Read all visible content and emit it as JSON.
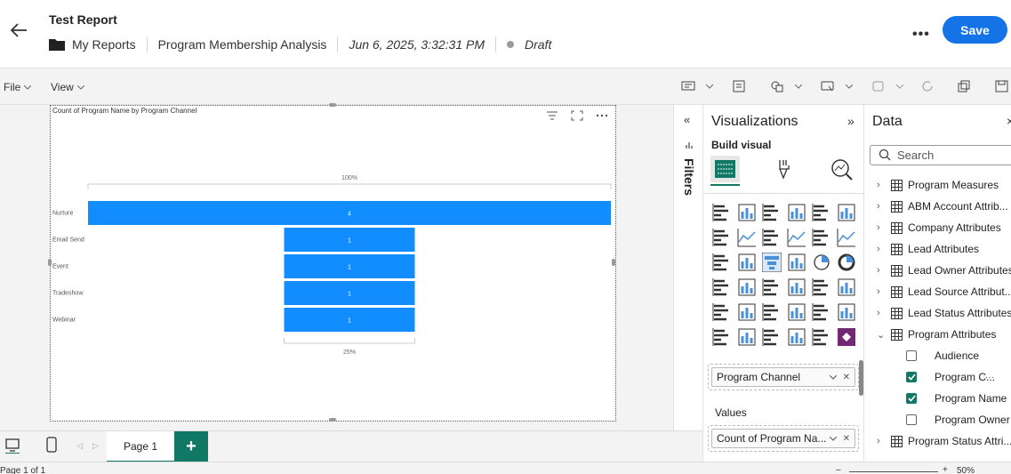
{
  "header": {
    "title": "Test Report",
    "breadcrumb": {
      "folder": "My Reports",
      "report": "Program Membership Analysis",
      "timestamp": "Jun 6, 2025, 3:32:31 PM",
      "status": "Draft"
    },
    "more_label": "•••",
    "save_label": "Save"
  },
  "toolbar": {
    "file_label": "File",
    "view_label": "View"
  },
  "visual": {
    "title": "Count of Program Name by Program Channel"
  },
  "chart_data": {
    "type": "funnel",
    "title": "Count of Program Name by Program Channel",
    "categories": [
      "Nurture",
      "Email Send",
      "Event",
      "Tradeshow",
      "Webinar"
    ],
    "values": [
      4,
      1,
      1,
      1,
      1
    ],
    "data_labels": [
      "4",
      "1",
      "1",
      "1",
      "1"
    ],
    "top_percent_label": "100%",
    "bottom_percent_label": "25%",
    "bar_color": "#118dff",
    "max": 4
  },
  "pages": {
    "tab_label": "Page 1",
    "add_label": "+"
  },
  "status": {
    "page_info": "Page 1 of 1",
    "zoom": "50%"
  },
  "filters": {
    "label": "Filters"
  },
  "visualizations": {
    "title": "Visualizations",
    "build_label": "Build visual",
    "axis_field": "Program Channel",
    "values_label": "Values",
    "values_field": "Count of Program Na..."
  },
  "data_pane": {
    "title": "Data",
    "search_placeholder": "Search",
    "tree": [
      {
        "label": "Program Measures",
        "icon": "calculator-icon"
      },
      {
        "label": "ABM Account Attrib...",
        "icon": "table-icon"
      },
      {
        "label": "Company Attributes",
        "icon": "table-icon"
      },
      {
        "label": "Lead Attributes",
        "icon": "table-icon"
      },
      {
        "label": "Lead Owner Attributes",
        "icon": "table-icon"
      },
      {
        "label": "Lead Source Attribut...",
        "icon": "table-icon"
      },
      {
        "label": "Lead Status Attributes",
        "icon": "table-icon"
      },
      {
        "label": "Program Attributes",
        "icon": "table-icon"
      }
    ],
    "children": [
      {
        "label": "Audience",
        "checked": false
      },
      {
        "label": "Program C...",
        "checked": true
      },
      {
        "label": "Program Name",
        "checked": true
      },
      {
        "label": "Program Owner",
        "checked": false
      }
    ],
    "last": {
      "label": "Program Status Attri...",
      "icon": "table-icon"
    }
  }
}
